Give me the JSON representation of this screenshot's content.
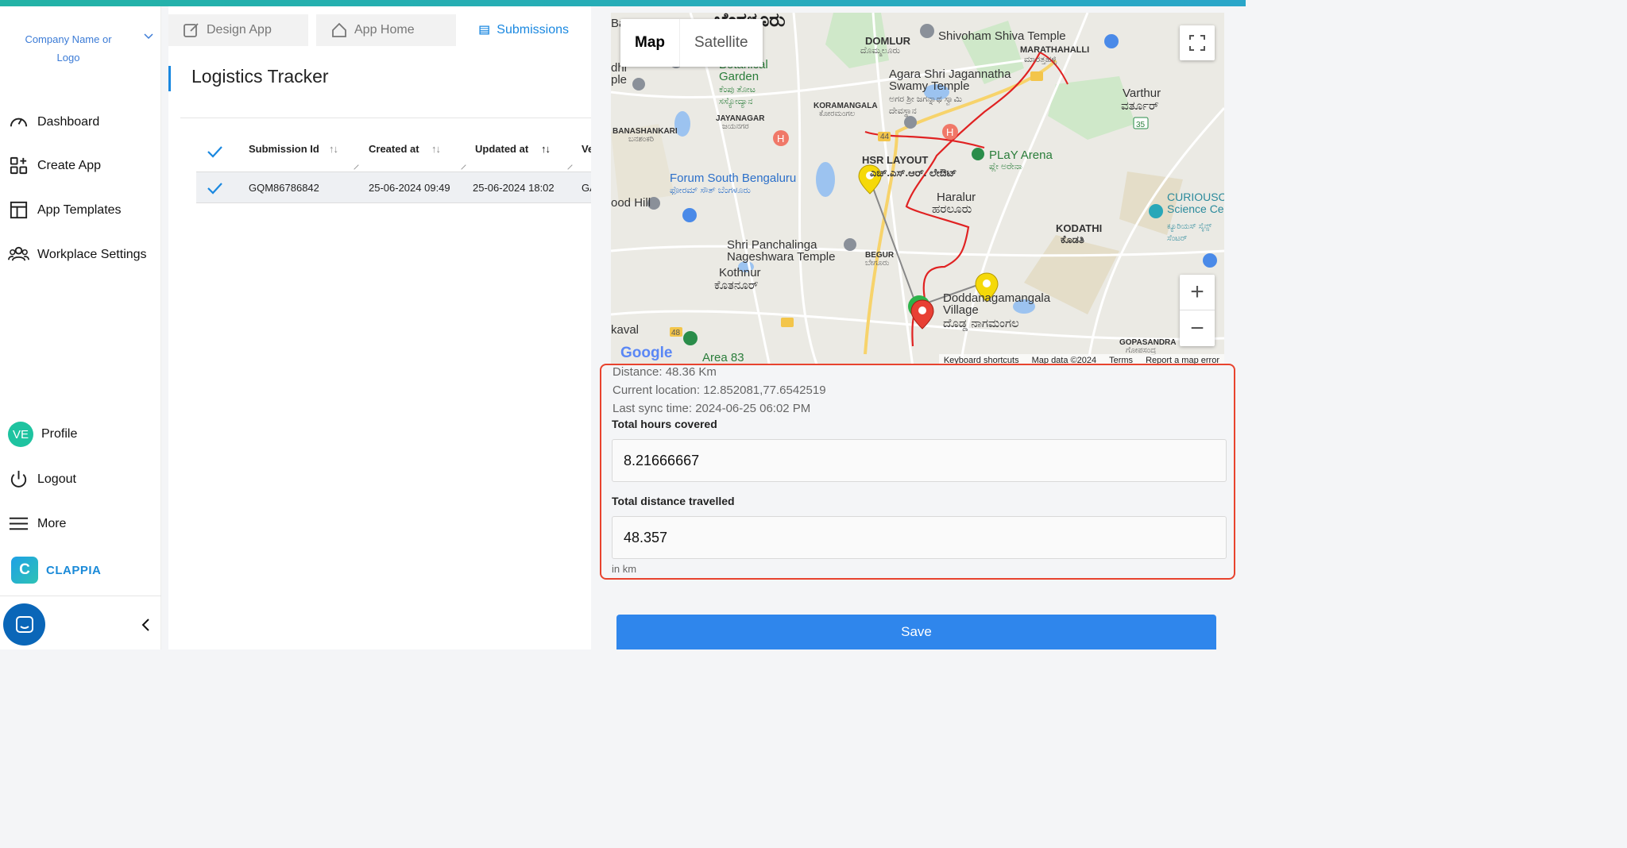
{
  "sidebar": {
    "company": "Company Name or Logo",
    "nav": [
      {
        "label": "Dashboard",
        "icon": "gauge-icon"
      },
      {
        "label": "Create App",
        "icon": "create-app-icon"
      },
      {
        "label": "App Templates",
        "icon": "templates-icon"
      },
      {
        "label": "Workplace Settings",
        "icon": "users-icon"
      }
    ],
    "profile": {
      "initials": "VE",
      "label": "Profile"
    },
    "logout": "Logout",
    "more": "More",
    "brand": "CLAPPIA"
  },
  "tabs": [
    {
      "label": "Design App",
      "icon": "edit-icon"
    },
    {
      "label": "App Home",
      "icon": "home-icon"
    },
    {
      "label": "Submissions",
      "icon": "list-icon"
    }
  ],
  "page": {
    "title": "Logistics Tracker"
  },
  "table": {
    "columns": [
      "Submission Id",
      "Created at",
      "Updated at",
      "Ve"
    ],
    "rows": [
      {
        "id": "GQM86786842",
        "created": "25-06-2024 09:49",
        "updated": "25-06-2024 18:02",
        "extra": "GA"
      }
    ]
  },
  "map": {
    "type_buttons": [
      "Map",
      "Satellite"
    ],
    "labels": {
      "city": "ಬೆಂಗಳೂರು",
      "domlur": "DOMLUR",
      "domlur_kn": "ದೊಮ್ಮಲೂರು",
      "shivoham": "Shivoham Shiva Temple",
      "marathahalli": "MARATHAHALLI",
      "marathahalli_kn": "ಮಾರತ್ತಹಳ್ಳಿ",
      "botanical": "Botanical Garden",
      "botanical_kn": "ಕೆಂಪು ತೋಟ ಸಸ್ಯೋದ್ಯಾನ",
      "agara": "Agara Shri Jagannatha Swamy Temple",
      "agara_kn": "ಅಗರ ಶ್ರೀ ಜಗನ್ನಾಥ ಸ್ವಾಮಿ ದೇವಸ್ಥಾನ",
      "varthur": "Varthur",
      "varthur_kn": "ವರ್ತೂರ್",
      "koramangala": "KORAMANGALA",
      "koramangala_kn": "ಕೋರಮಂಗಲ",
      "jayanagar": "JAYANAGAR",
      "jayanagar_kn": "ಜಯನಗರ",
      "banashankari": "BANASHANKARI",
      "banashankari_kn": "ಬನಶಂಕರಿ",
      "hsr": "HSR LAYOUT",
      "hsr_kn": "ಎಚ್.ಎಸ್.ಆರ್. ಲೇಔಟ್",
      "play": "PLaY Arena",
      "play_kn": "ಪ್ಲೇ ಅರೇನಾ",
      "forum": "Forum South Bengaluru",
      "forum_kn": "ಫೋರಮ್ ಸೌತ್ ಬೆಂಗಳೂರು",
      "haralur": "Haralur",
      "haralur_kn": "ಹರಲೂರು",
      "curious": "CURIOUSC Science Ce",
      "curious_kn": "ಕ್ಯೂರಿಯಸ್ ಸೈನ್ಸ್ ಸೆಂಟರ್",
      "kodathi": "KODATHI",
      "kodathi_kn": "ಕೊಡತಿ",
      "panchalinga": "Shri Panchalinga Nageshwara Temple",
      "begur": "BEGUR",
      "begur_kn": "ಬೇಗೂರು",
      "kothnur": "Kothnur",
      "kothnur_kn": "ಕೊತನೂರ್",
      "doddanagamangala": "Doddanagamangala Village",
      "doddanagamangala_kn": "ದೊಡ್ಡ ನಾಗಮಂಗಲ",
      "gopasandra": "GOPASANDRA",
      "gopasandra_kn": "ಗೋಪಸಂದ್ರ",
      "area83": "Area 83",
      "kaval": "kaval",
      "hill": "ood Hill",
      "left_dhi": "dhi ple",
      "left_ba": "Ba",
      "varthur_road": "35",
      "r44": "44",
      "r48": "48",
      "google": "Google"
    },
    "footer": [
      "Keyboard shortcuts",
      "Map data ©2024",
      "Terms",
      "Report a map error"
    ]
  },
  "info": {
    "distance": "Distance: 48.36 Km",
    "current_location": "Current location: 12.852081,77.6542519",
    "last_sync": "Last sync time: 2024-06-25 06:02 PM",
    "hours_label": "Total hours covered",
    "hours_value": "8.21666667",
    "distance_label": "Total distance travelled",
    "distance_value": "48.357",
    "unit": "in km"
  },
  "save_label": "Save",
  "colors": {
    "accent": "#1a88e0",
    "save": "#2f86ec",
    "highlight": "#e8432e",
    "route": "#e02222",
    "brand": "#1a8ad8"
  }
}
